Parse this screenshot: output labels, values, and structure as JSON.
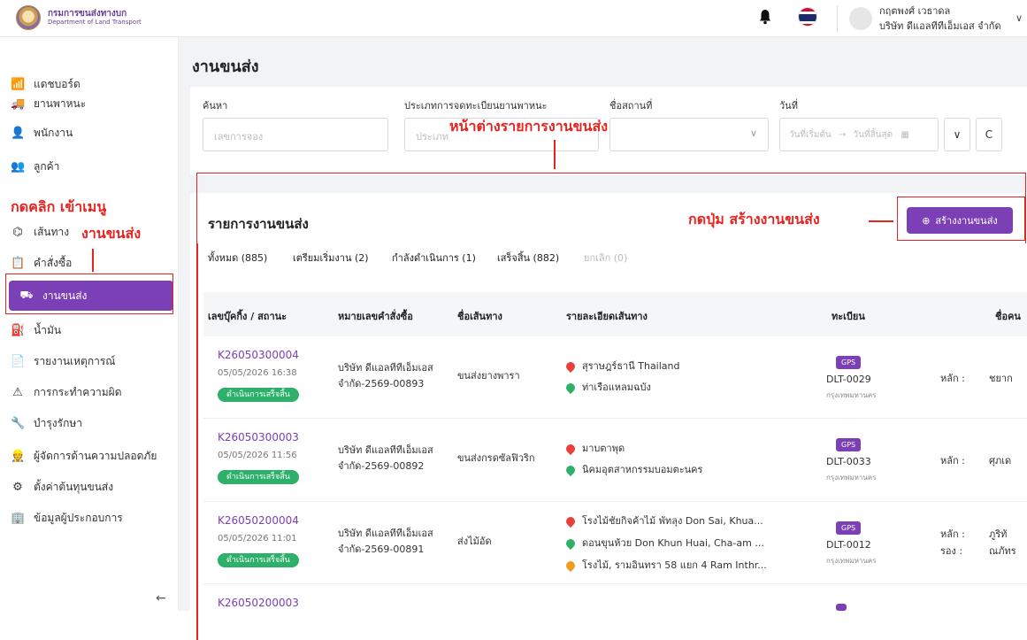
{
  "header": {
    "logo_th": "กรมการขนส่งทางบก",
    "logo_en": "Department of Land Transport",
    "user_name": "กฤตพงศ์ เวธาดล",
    "user_company": "บริษัท ดีแอลทีทีเอ็มเอส จำกัด",
    "chevron": "∨"
  },
  "sidebar": {
    "items": [
      {
        "label": "แดชบอร์ด",
        "icon": "chart-icon",
        "glyph": "📶"
      },
      {
        "label": "ยานพาหนะ",
        "icon": "truck-icon",
        "glyph": "🚚"
      },
      {
        "label": "พนักงาน",
        "icon": "person-icon",
        "glyph": "👤"
      },
      {
        "label": "ลูกค้า",
        "icon": "customers-icon",
        "glyph": "👥"
      },
      {
        "label": "เส้นทาง",
        "icon": "route-icon",
        "glyph": "⌬"
      },
      {
        "label": "คำสั่งซื้อ",
        "icon": "clipboard-icon",
        "glyph": "📋"
      },
      {
        "label": "งานขนส่ง",
        "icon": "transport-job-icon",
        "glyph": "⛟"
      },
      {
        "label": "น้ำมัน",
        "icon": "fuel-icon",
        "glyph": "⛽"
      },
      {
        "label": "รายงานเหตุการณ์",
        "icon": "report-icon",
        "glyph": "📄"
      },
      {
        "label": "การกระทำความผิด",
        "icon": "violation-icon",
        "glyph": "⚠"
      },
      {
        "label": "บำรุงรักษา",
        "icon": "wrench-icon",
        "glyph": "🔧"
      },
      {
        "label": "ผู้จัดการด้านความปลอดภัย",
        "icon": "safety-manager-icon",
        "glyph": "👷"
      },
      {
        "label": "ตั้งค่าต้นทุนขนส่ง",
        "icon": "settings-icon",
        "glyph": "⚙"
      },
      {
        "label": "ข้อมูลผู้ประกอบการ",
        "icon": "building-icon",
        "glyph": "🏢"
      }
    ],
    "collapse_glyph": "←"
  },
  "page": {
    "title": "งานขนส่ง"
  },
  "filters": {
    "search_label": "ค้นหา",
    "search_placeholder": "เลขการจอง",
    "type_label": "ประเภทการจดทะเบียนยานพาหนะ",
    "type_placeholder": "ประเภท",
    "location_label": "ชื่อสถานที่",
    "date_label": "วันที่",
    "date_start": "วันที่เริ่มต้น",
    "date_arrow": "→",
    "date_end": "วันที่สิ้นสุด",
    "expand_glyph": "∨",
    "reset_glyph": "C"
  },
  "list": {
    "title": "รายการงานขนส่ง",
    "create_label": "สร้างงานขนส่ง",
    "tabs": [
      {
        "label": "ทั้งหมด (885)"
      },
      {
        "label": "เตรียมเริ่มงาน (2)"
      },
      {
        "label": "กำลังดำเนินการ (1)"
      },
      {
        "label": "เสร็จสิ้น (882)"
      },
      {
        "label": "ยกเลิก (0)"
      }
    ],
    "columns": [
      "เลขบุ๊คกิ้ง / สถานะ",
      "หมายเลขคำสั่งซื้อ",
      "ชื่อเส้นทาง",
      "รายละเอียดเส้นทาง",
      "ทะเบียน",
      "ชื่อคน"
    ],
    "rows": [
      {
        "booking": "K26050300004",
        "datetime": "05/05/2026 16:38",
        "status": "ดำเนินการเสร็จสิ้น",
        "order_1": "บริษัท ดีแอลทีทีเอ็มเอส",
        "order_2": "จำกัด-2569-00893",
        "route_name": "ขนส่งยางพารา",
        "stops": [
          {
            "text": "สุราษฎร์ธานี Thailand",
            "color": "#e8413c"
          },
          {
            "text": "ท่าเรือแหลมฉบัง",
            "color": "#2db06a"
          }
        ],
        "gps": "GPS",
        "plate": "DLT-0029",
        "province": "กรุงเทพมหานคร",
        "driver_label_1": "หลัก :",
        "driver_1": "ชยาก"
      },
      {
        "booking": "K26050300003",
        "datetime": "05/05/2026 11:56",
        "status": "ดำเนินการเสร็จสิ้น",
        "order_1": "บริษัท ดีแอลทีทีเอ็มเอส",
        "order_2": "จำกัด-2569-00892",
        "route_name": "ขนส่งกรดซัลฟิวริก",
        "stops": [
          {
            "text": "มาบตาพุด",
            "color": "#e8413c"
          },
          {
            "text": "นิคมอุตสาหกรรมบอมตะนคร",
            "color": "#2db06a"
          }
        ],
        "gps": "GPS",
        "plate": "DLT-0033",
        "province": "กรุงเทพมหานคร",
        "driver_label_1": "หลัก :",
        "driver_1": "ศุภเด"
      },
      {
        "booking": "K26050200004",
        "datetime": "05/05/2026 11:01",
        "status": "ดำเนินการเสร็จสิ้น",
        "order_1": "บริษัท ดีแอลทีทีเอ็มเอส",
        "order_2": "จำกัด-2569-00891",
        "route_name": "ส่งไม้อัด",
        "stops": [
          {
            "text": "โรงไม้ชัยกิจค้าไม้ พัทลุง Don Sai, Khua...",
            "color": "#e8413c"
          },
          {
            "text": "ดอนขุนห้วย Don Khun Huai, Cha-am ...",
            "color": "#2db06a"
          },
          {
            "text": "โรงไม้, รามอินทรา 58 แยก 4 Ram Inthr...",
            "color": "#f29c1f"
          }
        ],
        "gps": "GPS",
        "plate": "DLT-0012",
        "province": "กรุงเทพมหานคร",
        "driver_label_1": "หลัก :",
        "driver_1": "ภูริทั",
        "driver_label_2": "รอง :",
        "driver_2": "ณภัทร"
      },
      {
        "booking": "K26050200003",
        "gps": "GPS"
      }
    ]
  },
  "annotations": {
    "click_menu_1": "กดคลิก เข้าเมนู",
    "click_menu_2": "งานขนส่ง",
    "list_window": "หน้าต่างรายการงานขนส่ง",
    "press_button": "กดปุ่ม สร้างงานขนส่ง"
  }
}
